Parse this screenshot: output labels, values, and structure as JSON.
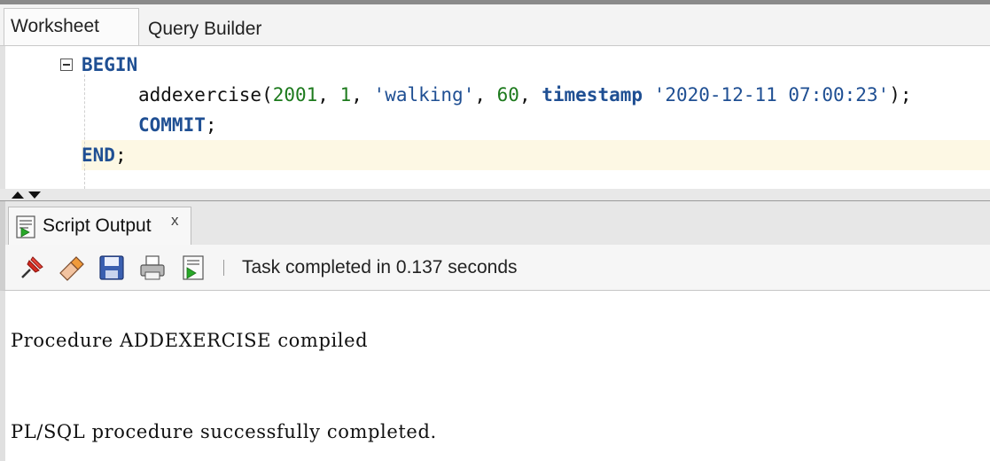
{
  "tabs": {
    "worksheet": "Worksheet",
    "query_builder": "Query Builder"
  },
  "editor": {
    "lines": {
      "begin": "BEGIN",
      "call_name": "addexercise(",
      "arg1": "2001",
      "sep1": ", ",
      "arg2": "1",
      "sep2": ", ",
      "arg3": "'walking'",
      "sep3": ", ",
      "arg4": "60",
      "sep4": ", ",
      "ts_kw": "timestamp",
      "ts_space": " ",
      "ts_val": "'2020-12-11 07:00:23'",
      "call_end": ");",
      "commit": "COMMIT",
      "commit_end": ";",
      "end": "END",
      "end_semi": ";"
    }
  },
  "output_panel": {
    "tab_label": "Script Output",
    "close_label": "x",
    "toolbar": {
      "icons": [
        "pin-icon",
        "eraser-icon",
        "save-icon",
        "print-icon",
        "run-script-icon"
      ]
    },
    "status": "Task completed in 0.137 seconds",
    "messages": [
      "Procedure ADDEXERCISE compiled",
      "PL/SQL procedure successfully completed."
    ]
  },
  "colors": {
    "keyword": "#1f4f93",
    "number": "#1d7a1d",
    "string": "#1f4f93",
    "current_line": "#fdf8e4"
  }
}
